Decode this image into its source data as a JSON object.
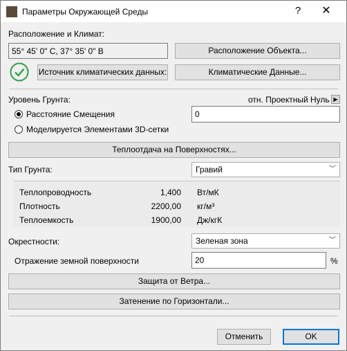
{
  "window": {
    "title": "Параметры Окружающей Среды",
    "help": "?",
    "close": "✕"
  },
  "location": {
    "section_label": "Расположение и Климат:",
    "coordinates": "55° 45' 0\" С, 37° 35' 0\" В",
    "location_button": "Расположение Объекта...",
    "climate_source_button": "Источник климатических данных:",
    "climate_data_button": "Климатические Данные..."
  },
  "ground_level": {
    "label": "Уровень Грунта:",
    "reference": "отн. Проектный Нуль",
    "option_offset": "Расстояние Смещения",
    "option_mesh": "Моделируется Элементами 3D-сетки",
    "offset_value": "0",
    "heat_transfer_button": "Теплоотдача на Поверхностях..."
  },
  "soil": {
    "label": "Тип Грунта:",
    "selected": "Гравий",
    "properties": [
      {
        "name": "Теплопроводность",
        "value": "1,400",
        "unit": "Вт/мК"
      },
      {
        "name": "Плотность",
        "value": "2200,00",
        "unit": "кг/м³"
      },
      {
        "name": "Теплоемкость",
        "value": "1900,00",
        "unit": "Дж/кгК"
      }
    ]
  },
  "surroundings": {
    "label": "Окрестности:",
    "selected": "Зеленая зона",
    "reflection_label": "Отражение земной поверхности",
    "reflection_value": "20",
    "reflection_unit": "%",
    "wind_button": "Защита от Ветра...",
    "horizon_button": "Затенение по Горизонтали..."
  },
  "footer": {
    "cancel": "Отменить",
    "ok": "OK"
  },
  "colors": {
    "check_green": "#2ea043",
    "ok_border": "#0078d7"
  }
}
